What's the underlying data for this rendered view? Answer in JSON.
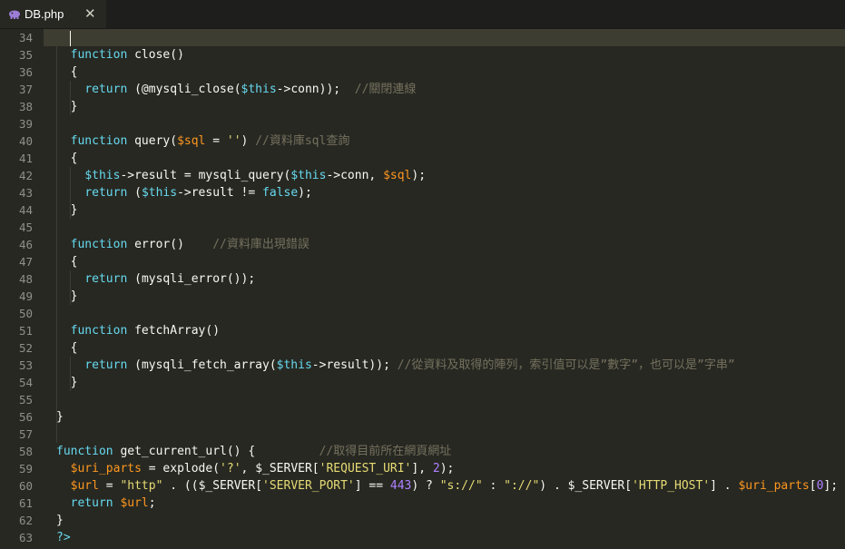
{
  "tab": {
    "filename": "DB.php",
    "close_glyph": "✕"
  },
  "colors": {
    "background": "#272822",
    "keyword": "#66d9ef",
    "function": "#a6e22e",
    "variable": "#fd971f",
    "string": "#e6db74",
    "comment": "#75715e",
    "plain": "#f8f8f2",
    "php_icon": "#9b7cd6"
  },
  "lines": [
    {
      "n": "34",
      "indent": "",
      "tokens": []
    },
    {
      "n": "35",
      "indent": "  ",
      "tokens": [
        {
          "c": "kw",
          "t": "function "
        },
        {
          "c": "id",
          "t": "close"
        },
        {
          "c": "pl",
          "t": "()"
        }
      ]
    },
    {
      "n": "36",
      "indent": "  ",
      "tokens": [
        {
          "c": "pl",
          "t": "{"
        }
      ]
    },
    {
      "n": "37",
      "indent": "    ",
      "tokens": [
        {
          "c": "kw",
          "t": "return "
        },
        {
          "c": "pl",
          "t": "(@"
        },
        {
          "c": "id",
          "t": "mysqli_close"
        },
        {
          "c": "pl",
          "t": "("
        },
        {
          "c": "kw",
          "t": "$this"
        },
        {
          "c": "pl",
          "t": "->"
        },
        {
          "c": "id",
          "t": "conn"
        },
        {
          "c": "pl",
          "t": "));  "
        },
        {
          "c": "cm",
          "t": "//關閉連線"
        }
      ]
    },
    {
      "n": "38",
      "indent": "  ",
      "tokens": [
        {
          "c": "pl",
          "t": "}"
        }
      ]
    },
    {
      "n": "39",
      "indent": "",
      "tokens": []
    },
    {
      "n": "40",
      "indent": "  ",
      "tokens": [
        {
          "c": "kw",
          "t": "function "
        },
        {
          "c": "id",
          "t": "query"
        },
        {
          "c": "pl",
          "t": "("
        },
        {
          "c": "var",
          "t": "$sql"
        },
        {
          "c": "pl",
          "t": " = "
        },
        {
          "c": "str",
          "t": "''"
        },
        {
          "c": "pl",
          "t": ") "
        },
        {
          "c": "cm",
          "t": "//資料庫sql查詢"
        }
      ]
    },
    {
      "n": "41",
      "indent": "  ",
      "tokens": [
        {
          "c": "pl",
          "t": "{"
        }
      ]
    },
    {
      "n": "42",
      "indent": "    ",
      "tokens": [
        {
          "c": "kw",
          "t": "$this"
        },
        {
          "c": "pl",
          "t": "->"
        },
        {
          "c": "id",
          "t": "result"
        },
        {
          "c": "pl",
          "t": " = "
        },
        {
          "c": "id",
          "t": "mysqli_query"
        },
        {
          "c": "pl",
          "t": "("
        },
        {
          "c": "kw",
          "t": "$this"
        },
        {
          "c": "pl",
          "t": "->"
        },
        {
          "c": "id",
          "t": "conn"
        },
        {
          "c": "pl",
          "t": ", "
        },
        {
          "c": "var",
          "t": "$sql"
        },
        {
          "c": "pl",
          "t": ");"
        }
      ]
    },
    {
      "n": "43",
      "indent": "    ",
      "tokens": [
        {
          "c": "kw",
          "t": "return "
        },
        {
          "c": "pl",
          "t": "("
        },
        {
          "c": "kw",
          "t": "$this"
        },
        {
          "c": "pl",
          "t": "->"
        },
        {
          "c": "id",
          "t": "result"
        },
        {
          "c": "pl",
          "t": " != "
        },
        {
          "c": "kw",
          "t": "false"
        },
        {
          "c": "pl",
          "t": ");"
        }
      ]
    },
    {
      "n": "44",
      "indent": "  ",
      "tokens": [
        {
          "c": "pl",
          "t": "}"
        }
      ]
    },
    {
      "n": "45",
      "indent": "",
      "tokens": []
    },
    {
      "n": "46",
      "indent": "  ",
      "tokens": [
        {
          "c": "kw",
          "t": "function "
        },
        {
          "c": "id",
          "t": "error"
        },
        {
          "c": "pl",
          "t": "()    "
        },
        {
          "c": "cm",
          "t": "//資料庫出現錯誤"
        }
      ]
    },
    {
      "n": "47",
      "indent": "  ",
      "tokens": [
        {
          "c": "pl",
          "t": "{"
        }
      ]
    },
    {
      "n": "48",
      "indent": "    ",
      "tokens": [
        {
          "c": "kw",
          "t": "return "
        },
        {
          "c": "pl",
          "t": "("
        },
        {
          "c": "id",
          "t": "mysqli_error"
        },
        {
          "c": "pl",
          "t": "());"
        }
      ]
    },
    {
      "n": "49",
      "indent": "  ",
      "tokens": [
        {
          "c": "pl",
          "t": "}"
        }
      ]
    },
    {
      "n": "50",
      "indent": "",
      "tokens": []
    },
    {
      "n": "51",
      "indent": "  ",
      "tokens": [
        {
          "c": "kw",
          "t": "function "
        },
        {
          "c": "id",
          "t": "fetchArray"
        },
        {
          "c": "pl",
          "t": "()"
        }
      ]
    },
    {
      "n": "52",
      "indent": "  ",
      "tokens": [
        {
          "c": "pl",
          "t": "{"
        }
      ]
    },
    {
      "n": "53",
      "indent": "    ",
      "tokens": [
        {
          "c": "kw",
          "t": "return "
        },
        {
          "c": "pl",
          "t": "("
        },
        {
          "c": "id",
          "t": "mysqli_fetch_array"
        },
        {
          "c": "pl",
          "t": "("
        },
        {
          "c": "kw",
          "t": "$this"
        },
        {
          "c": "pl",
          "t": "->"
        },
        {
          "c": "id",
          "t": "result"
        },
        {
          "c": "pl",
          "t": ")); "
        },
        {
          "c": "cm",
          "t": "//從資料及取得的陣列，索引值可以是”數字”，也可以是”字串”"
        }
      ]
    },
    {
      "n": "54",
      "indent": "  ",
      "tokens": [
        {
          "c": "pl",
          "t": "}"
        }
      ]
    },
    {
      "n": "55",
      "indent": "",
      "tokens": []
    },
    {
      "n": "56",
      "indent": "",
      "tokens": [
        {
          "c": "pl",
          "t": "}"
        }
      ]
    },
    {
      "n": "57",
      "indent": "",
      "tokens": []
    },
    {
      "n": "58",
      "indent": "",
      "tokens": [
        {
          "c": "kw",
          "t": "function "
        },
        {
          "c": "id",
          "t": "get_current_url"
        },
        {
          "c": "pl",
          "t": "() {         "
        },
        {
          "c": "cm",
          "t": "//取得目前所在網頁網址"
        }
      ]
    },
    {
      "n": "59",
      "indent": "  ",
      "tokens": [
        {
          "c": "var",
          "t": "$uri_parts"
        },
        {
          "c": "pl",
          "t": " = "
        },
        {
          "c": "id",
          "t": "explode"
        },
        {
          "c": "pl",
          "t": "("
        },
        {
          "c": "str",
          "t": "'?'"
        },
        {
          "c": "pl",
          "t": ", "
        },
        {
          "c": "id",
          "t": "$_SERVER"
        },
        {
          "c": "pl",
          "t": "["
        },
        {
          "c": "str",
          "t": "'REQUEST_URI'"
        },
        {
          "c": "pl",
          "t": "], "
        },
        {
          "c": "num",
          "t": "2"
        },
        {
          "c": "pl",
          "t": ");"
        }
      ]
    },
    {
      "n": "60",
      "indent": "  ",
      "tokens": [
        {
          "c": "var",
          "t": "$url"
        },
        {
          "c": "pl",
          "t": " = "
        },
        {
          "c": "str",
          "t": "\"http\""
        },
        {
          "c": "pl",
          "t": " . (("
        },
        {
          "c": "id",
          "t": "$_SERVER"
        },
        {
          "c": "pl",
          "t": "["
        },
        {
          "c": "str",
          "t": "'SERVER_PORT'"
        },
        {
          "c": "pl",
          "t": "] == "
        },
        {
          "c": "num",
          "t": "443"
        },
        {
          "c": "pl",
          "t": ") ? "
        },
        {
          "c": "str",
          "t": "\"s://\""
        },
        {
          "c": "pl",
          "t": " : "
        },
        {
          "c": "str",
          "t": "\"://\""
        },
        {
          "c": "pl",
          "t": ") . "
        },
        {
          "c": "id",
          "t": "$_SERVER"
        },
        {
          "c": "pl",
          "t": "["
        },
        {
          "c": "str",
          "t": "'HTTP_HOST'"
        },
        {
          "c": "pl",
          "t": "] . "
        },
        {
          "c": "var",
          "t": "$uri_parts"
        },
        {
          "c": "pl",
          "t": "["
        },
        {
          "c": "num",
          "t": "0"
        },
        {
          "c": "pl",
          "t": "];"
        }
      ]
    },
    {
      "n": "61",
      "indent": "  ",
      "tokens": [
        {
          "c": "kw",
          "t": "return "
        },
        {
          "c": "var",
          "t": "$url"
        },
        {
          "c": "pl",
          "t": ";"
        }
      ]
    },
    {
      "n": "62",
      "indent": "",
      "tokens": [
        {
          "c": "pl",
          "t": "}"
        }
      ]
    },
    {
      "n": "63",
      "indent": "",
      "tokens": [
        {
          "c": "kw",
          "t": "?>"
        }
      ]
    }
  ]
}
